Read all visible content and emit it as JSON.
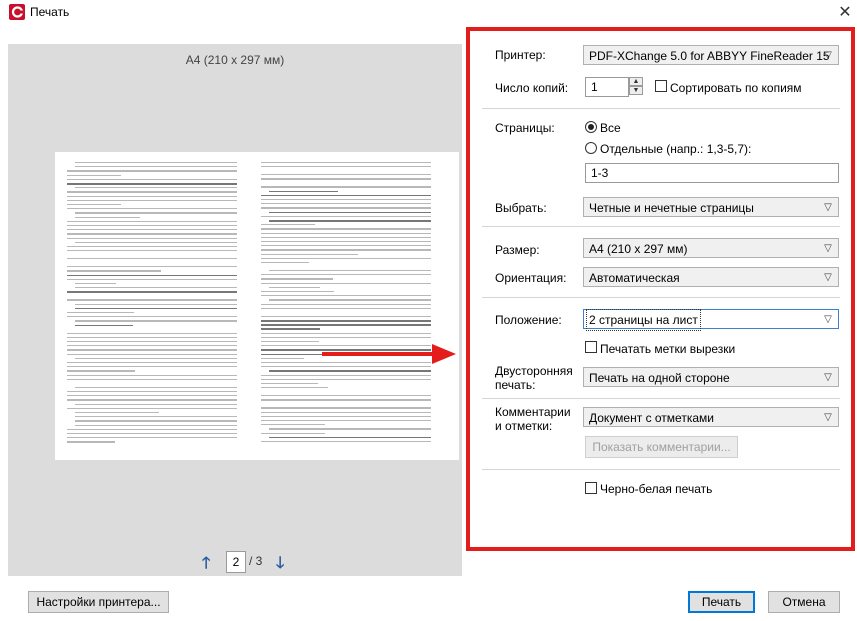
{
  "window": {
    "title": "Печать"
  },
  "preview": {
    "paper": "A4 (210 x 297 мм)",
    "page_current": "2",
    "page_total": "/ 3"
  },
  "settings": {
    "printer_label": "Принтер:",
    "printer_value": "PDF-XChange 5.0 for ABBYY FineReader 15",
    "copies_label": "Число копий:",
    "copies_value": "1",
    "collate_label": "Сортировать по копиям",
    "pages_label": "Страницы:",
    "pages_all": "Все",
    "pages_some": "Отдельные (напр.: 1,3-5,7):",
    "pages_range_value": "1-3",
    "select_label": "Выбрать:",
    "select_value": "Четные и нечетные страницы",
    "size_label": "Размер:",
    "size_value": "A4 (210 x 297 мм)",
    "orientation_label": "Ориентация:",
    "orientation_value": "Автоматическая",
    "layout_label": "Положение:",
    "layout_value": "2 страницы на лист",
    "cutmarks_label": "Печатать метки вырезки",
    "duplex_label_1": "Двусторонняя",
    "duplex_label_2": "печать:",
    "duplex_value": "Печать на одной стороне",
    "comments_label_1": "Комментарии",
    "comments_label_2": "и отметки:",
    "comments_value": "Документ с отметками",
    "show_comments_button": "Показать комментарии...",
    "bw_label": "Черно-белая печать"
  },
  "footer": {
    "printer_settings_button": "Настройки принтера...",
    "print_button": "Печать",
    "cancel_button": "Отмена"
  },
  "colors": {
    "highlight": "#e31c1c",
    "accent": "#2a5d9f"
  }
}
